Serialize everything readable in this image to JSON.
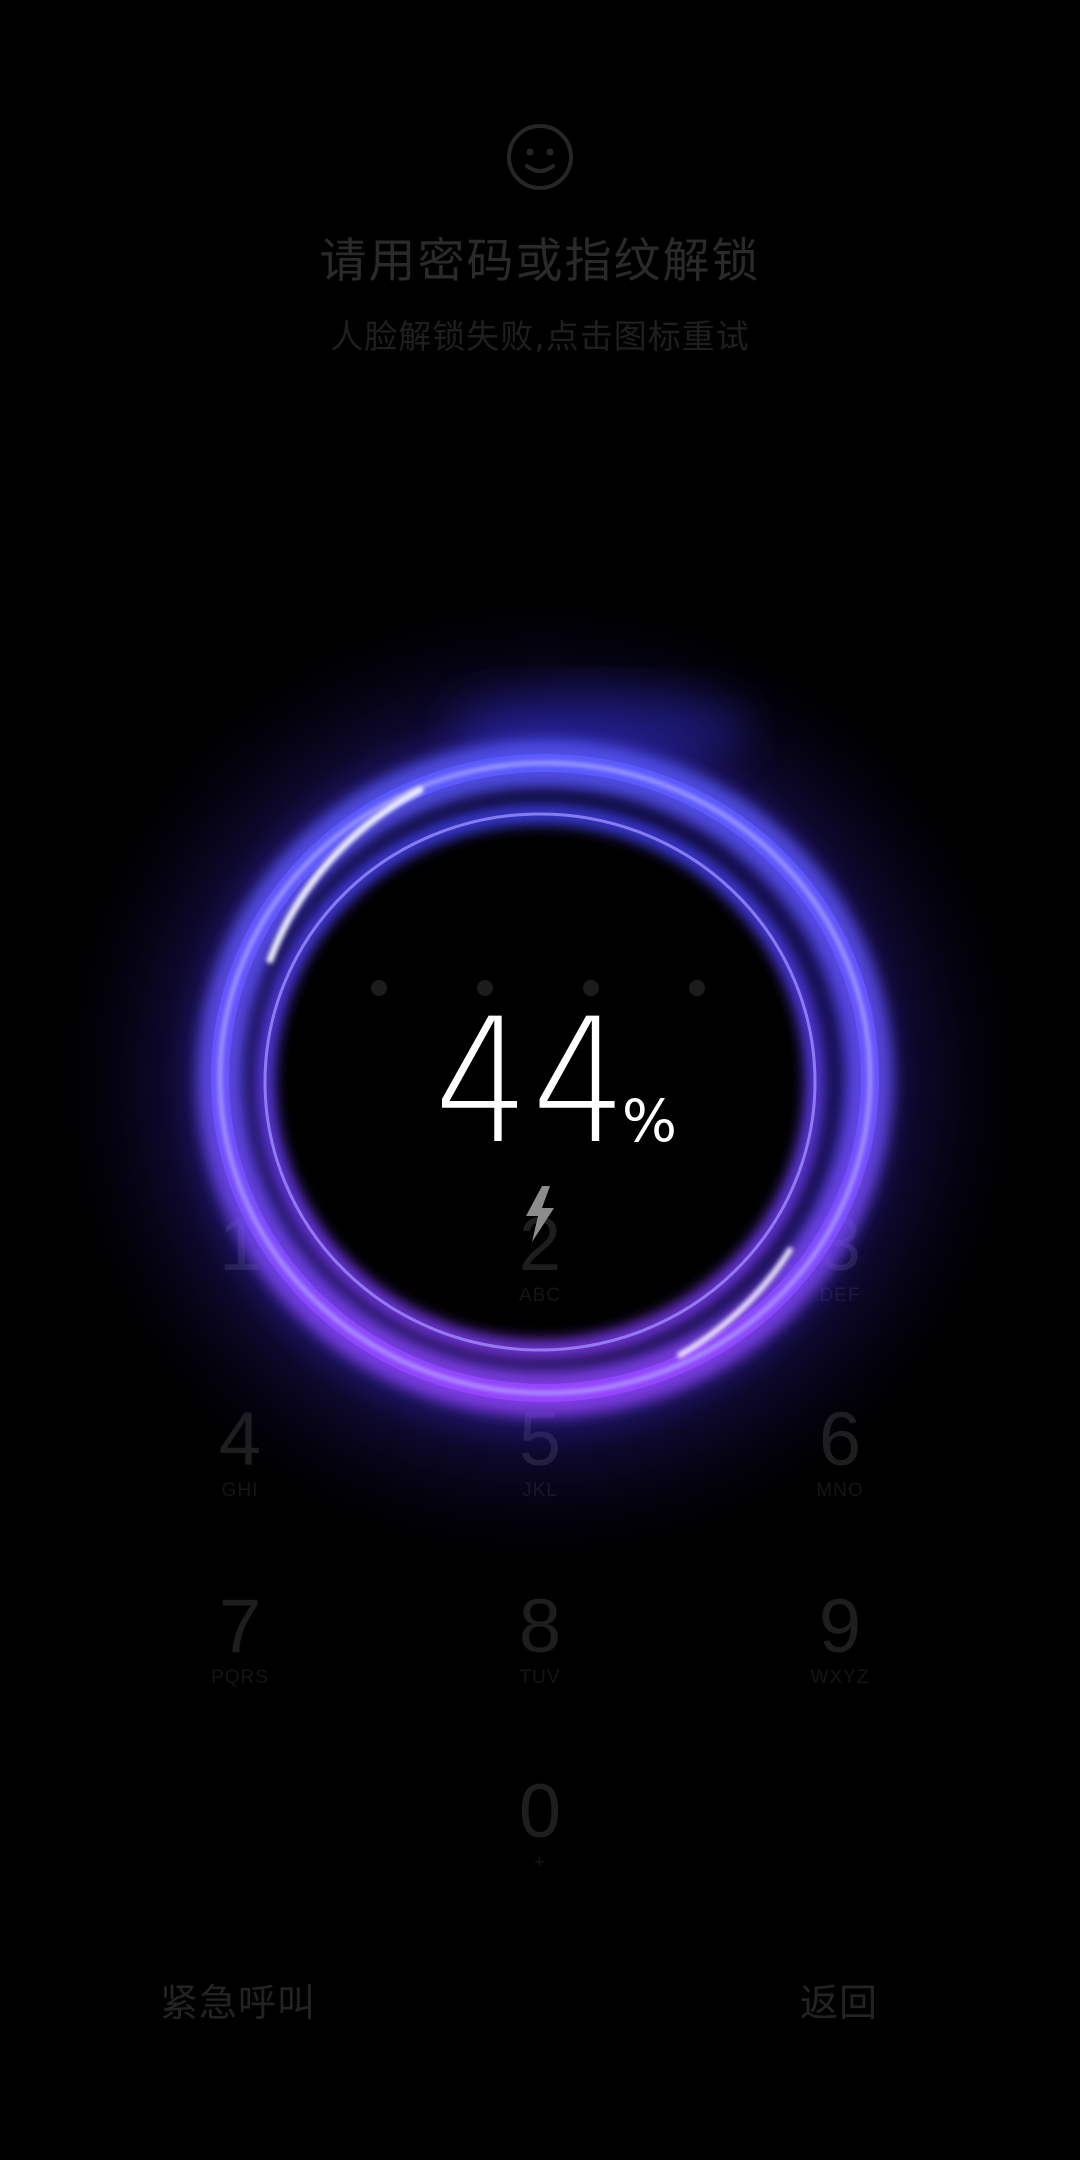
{
  "lock_prompt": {
    "title": "请用密码或指纹解锁",
    "subtitle": "人脸解锁失败,点击图标重试",
    "face_icon": "face-unlock-icon"
  },
  "keypad": {
    "keys": [
      {
        "digit": "1",
        "letters": ""
      },
      {
        "digit": "2",
        "letters": "ABC"
      },
      {
        "digit": "3",
        "letters": "DEF"
      },
      {
        "digit": "4",
        "letters": "GHI"
      },
      {
        "digit": "5",
        "letters": "JKL"
      },
      {
        "digit": "6",
        "letters": "MNO"
      },
      {
        "digit": "7",
        "letters": "PQRS"
      },
      {
        "digit": "8",
        "letters": "TUV"
      },
      {
        "digit": "9",
        "letters": "WXYZ"
      },
      {
        "digit": "0",
        "letters": "+"
      }
    ]
  },
  "bottom_actions": {
    "emergency_call": "紧急呼叫",
    "back": "返回"
  },
  "charging": {
    "battery_percent": "44",
    "unit": "%",
    "charging_icon": "lightning-bolt-icon",
    "ring_colors": {
      "top": "#4b4bff",
      "bottom": "#8a3cff",
      "highlight": "#ffffff"
    }
  }
}
